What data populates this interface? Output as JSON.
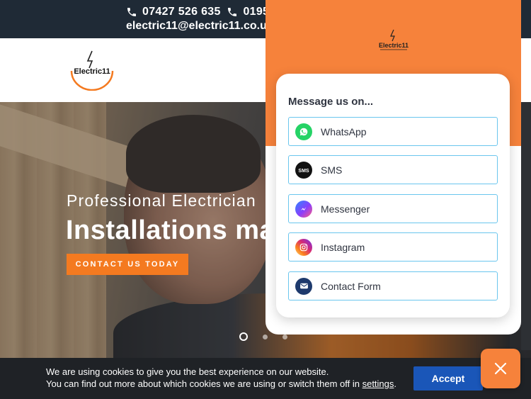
{
  "topbar": {
    "phone1": "07427 526 635",
    "phone2": "0195",
    "email": "electric11@electric11.co.uk"
  },
  "logo": {
    "text": "Electric11",
    "alt_text": "Electric11"
  },
  "hero": {
    "subtitle": "Professional Electrician",
    "title": "Installations ma",
    "cta_label": "CONTACT US TODAY",
    "slides": {
      "total": 3,
      "active_index": 0
    }
  },
  "chat_popup": {
    "logo_text": "Electric11",
    "title": "Message us on...",
    "options": [
      {
        "label": "WhatsApp",
        "icon": "whatsapp-icon",
        "color": "#25d366"
      },
      {
        "label": "SMS",
        "icon": "sms-icon",
        "color": "#111111"
      },
      {
        "label": "Messenger",
        "icon": "messenger-icon",
        "color": "#8a3ffc"
      },
      {
        "label": "Instagram",
        "icon": "instagram-icon",
        "color": "#e1306c"
      },
      {
        "label": "Contact Form",
        "icon": "mail-icon",
        "color": "#1e3a6d"
      }
    ]
  },
  "cookie_bar": {
    "line1": "We are using cookies to give you the best experience on our website.",
    "line2_pre": "You can find out more about which cookies we are using or switch them off in ",
    "line2_link": "settings",
    "line2_post": ".",
    "accept_label": "Accept"
  },
  "colors": {
    "brand_orange": "#f6823b",
    "cta_orange": "#f47a20",
    "topbar_bg": "#1f2a36",
    "accept_blue": "#1a56b8",
    "option_border": "#6ac6ee"
  }
}
